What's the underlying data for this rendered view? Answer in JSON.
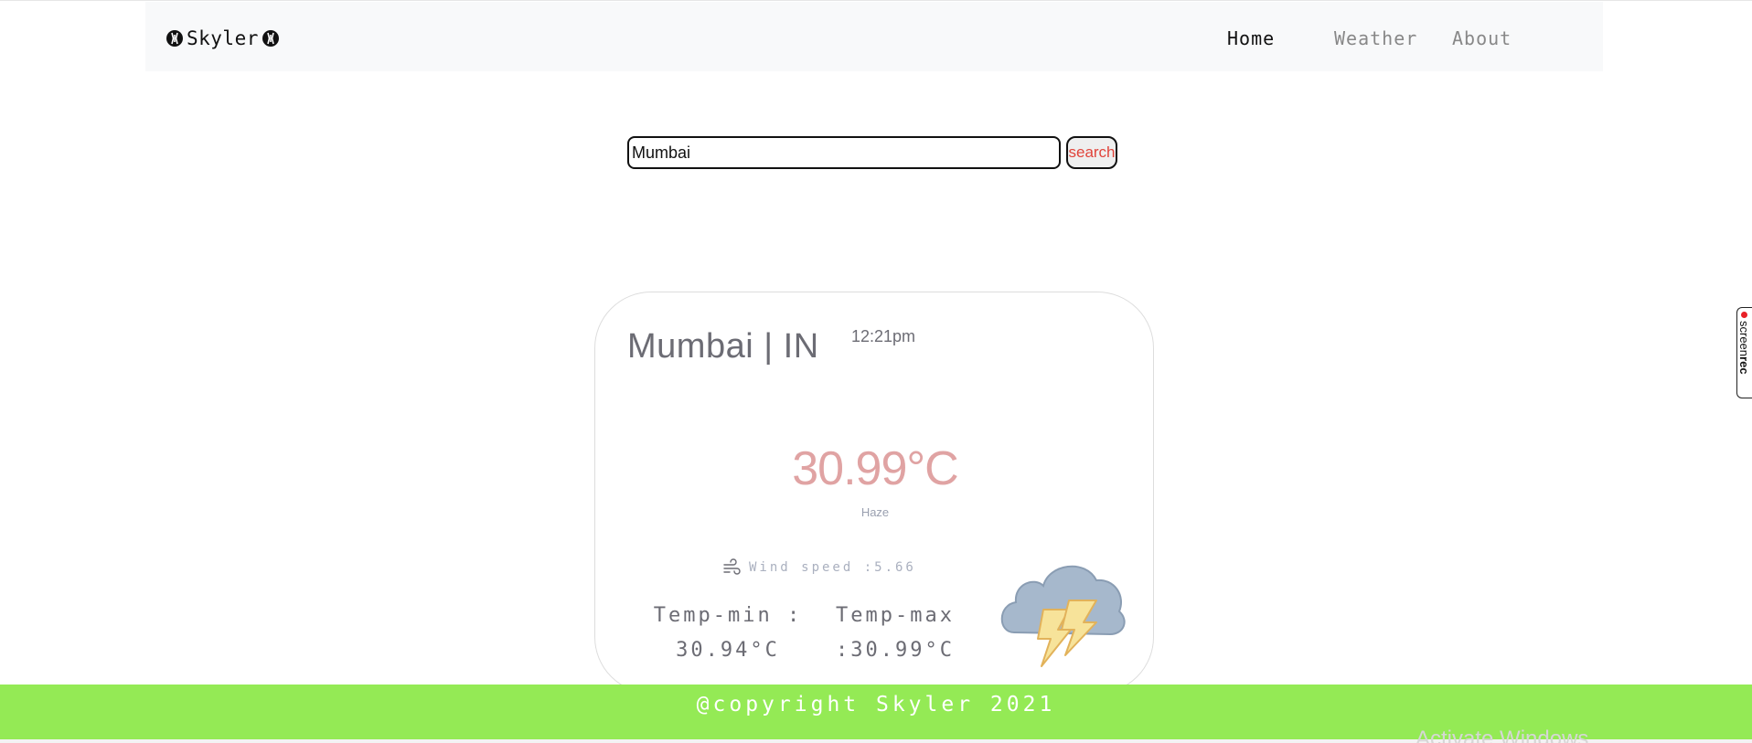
{
  "navbar": {
    "brand": "Skyler",
    "links": [
      {
        "label": "Home",
        "active": true
      },
      {
        "label": "Weather",
        "active": false
      },
      {
        "label": "About",
        "active": false
      }
    ]
  },
  "search": {
    "value": "Mumbai",
    "button_label": "search"
  },
  "weather": {
    "location": "Mumbai | IN",
    "time": "12:21pm",
    "temperature": "30.99°C",
    "condition": "Haze",
    "wind": "Wind speed :5.66",
    "temp_min_label": "Temp-min :",
    "temp_min_value": "30.94°C",
    "temp_max_label": "Temp-max",
    "temp_max_value": ":30.99°C",
    "icon": "thunderstorm-cloud-icon"
  },
  "footer": {
    "text": "@copyright Skyler 2021"
  },
  "overlays": {
    "os_watermark": "Activate Windows",
    "recorder_tab_prefix": "screen",
    "recorder_tab_bold": "rec"
  },
  "colors": {
    "footer_bg": "#94ea55",
    "temperature": "#e0a3a3",
    "search_button_text": "#e0443b",
    "navbar_bg": "#f8f9fa"
  }
}
